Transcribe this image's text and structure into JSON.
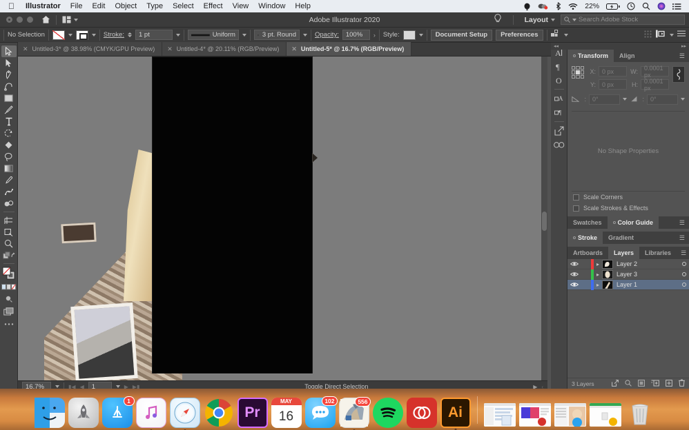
{
  "macbar": {
    "apple_icon": "apple-icon",
    "app_name": "Illustrator",
    "menus": [
      "File",
      "Edit",
      "Object",
      "Type",
      "Select",
      "Effect",
      "View",
      "Window",
      "Help"
    ],
    "status": {
      "battery_percent": "22%",
      "icons": [
        "dropbox-icon",
        "cloud-sync-icon",
        "bluetooth-icon",
        "wifi-icon",
        "battery-icon",
        "timemachine-icon",
        "spotlight-search-icon",
        "siri-icon",
        "control-center-icon"
      ]
    }
  },
  "appbar": {
    "title": "Adobe Illustrator 2020",
    "home_icon": "home-icon",
    "arrange_icon": "arrange-documents-icon",
    "bulb_icon": "discover-bulb-icon",
    "layout_label": "Layout",
    "search_placeholder": "Search Adobe Stock",
    "search_icon": "search-icon"
  },
  "control_bar": {
    "selection_status": "No Selection",
    "fill_label": "fill-swatch",
    "stroke_swatch_label": "stroke-swatch",
    "stroke_label": "Stroke:",
    "stroke_weight": "1 pt",
    "stroke_profile": "Uniform",
    "brush_definition": "3 pt. Round",
    "opacity_label": "Opacity:",
    "opacity_value": "100%",
    "style_label": "Style:",
    "document_setup": "Document Setup",
    "preferences": "Preferences",
    "align_icon": "align-objects-icon",
    "more_options_icon": "more-options-icon"
  },
  "tabs": [
    {
      "title": "Untitled-3* @ 38.98% (CMYK/GPU Preview)",
      "active": false,
      "close_icon": "close-icon"
    },
    {
      "title": "Untitled-4* @ 20.11% (RGB/Preview)",
      "active": false,
      "close_icon": "close-icon"
    },
    {
      "title": "Untitled-5* @ 16.7% (RGB/Preview)",
      "active": true,
      "close_icon": "close-icon"
    }
  ],
  "tools": [
    {
      "name": "selection-tool",
      "selected": true
    },
    {
      "name": "direct-selection-tool",
      "selected": false
    },
    {
      "name": "pen-tool",
      "selected": false
    },
    {
      "name": "curvature-tool",
      "selected": false
    },
    {
      "name": "rectangle-tool",
      "selected": false
    },
    {
      "name": "paintbrush-tool",
      "selected": false
    },
    {
      "name": "type-tool",
      "selected": false
    },
    {
      "name": "rotate-tool",
      "selected": false
    },
    {
      "name": "shape-builder-tool",
      "selected": false
    },
    {
      "name": "lasso-tool",
      "selected": false
    },
    {
      "name": "gradient-tool",
      "selected": false
    },
    {
      "name": "eyedropper-tool",
      "selected": false
    },
    {
      "name": "puppet-warp-tool",
      "selected": false
    },
    {
      "name": "blend-tool",
      "selected": false
    },
    {
      "name": "artboard-tool",
      "selected": false
    },
    {
      "name": "slice-tool",
      "selected": false
    },
    {
      "name": "zoom-tool",
      "selected": false
    },
    {
      "name": "screen-mode-tool",
      "selected": false
    },
    {
      "name": "fill-stroke-swatch",
      "selected": false
    },
    {
      "name": "color-mode-row",
      "selected": false
    },
    {
      "name": "drawing-mode-tool",
      "selected": false
    },
    {
      "name": "change-screen-mode-tool",
      "selected": false
    },
    {
      "name": "edit-toolbar-icon",
      "selected": false
    }
  ],
  "canvas": {
    "artboard_label": "artboard-1",
    "black_rect_color": "#040404",
    "background_color": "#7c7c7c"
  },
  "statusbar": {
    "zoom_level": "16.7%",
    "page_number": "1",
    "tool_hint": "Toggle Direct Selection",
    "first_icon": "first-page-icon",
    "prev_icon": "previous-page-icon",
    "next_icon": "next-page-icon",
    "last_icon": "last-page-icon"
  },
  "right_rail": [
    {
      "name": "character-panel-icon",
      "glyph": "A"
    },
    {
      "name": "paragraph-panel-icon",
      "glyph": "¶"
    },
    {
      "name": "opentype-panel-icon",
      "glyph": "O"
    },
    {
      "name": "character-styles-icon",
      "glyph": "A"
    },
    {
      "name": "paragraph-styles-icon",
      "glyph": "¶"
    },
    {
      "name": "asset-export-icon",
      "glyph": "⬈"
    },
    {
      "name": "links-panel-icon",
      "glyph": "∞"
    }
  ],
  "panels": {
    "transform": {
      "tabs": [
        {
          "label": "Transform",
          "active": true
        },
        {
          "label": "Align",
          "active": false
        }
      ],
      "menu_icon": "panel-menu-icon",
      "reference_point_icon": "reference-point-selector",
      "x_label": "X:",
      "x_value": "0 px",
      "y_label": "Y:",
      "y_value": "0 px",
      "w_label": "W:",
      "w_value": "0.0001 px",
      "h_label": "H:",
      "h_value": "0.0001 px",
      "angle_label": "angle-icon",
      "angle_value": "0°",
      "shear_label": "shear-icon",
      "shear_value": "0°",
      "link_icon": "constrain-proportions-icon",
      "no_shape_properties": "No Shape Properties",
      "scale_corners": "Scale Corners",
      "scale_strokes": "Scale Strokes & Effects"
    },
    "swatches_group": {
      "tabs": [
        {
          "label": "Swatches",
          "active": false
        },
        {
          "label": "Color Guide",
          "active": true
        }
      ],
      "menu_icon": "panel-menu-icon"
    },
    "stroke_group": {
      "tabs": [
        {
          "label": "Stroke",
          "active": true
        },
        {
          "label": "Gradient",
          "active": false
        }
      ],
      "menu_icon": "panel-menu-icon"
    },
    "layers": {
      "tabs": [
        {
          "label": "Artboards",
          "active": false
        },
        {
          "label": "Layers",
          "active": true
        },
        {
          "label": "Libraries",
          "active": false
        }
      ],
      "menu_icon": "panel-menu-icon",
      "rows": [
        {
          "name": "Layer 2",
          "color": "#ef3a3a",
          "selected": false,
          "eye_icon": "eye-icon",
          "expand_icon": "chevron-right-icon",
          "target_icon": "target-circle-icon"
        },
        {
          "name": "Layer 3",
          "color": "#34c24a",
          "selected": false,
          "eye_icon": "eye-icon",
          "expand_icon": "chevron-right-icon",
          "target_icon": "target-circle-icon"
        },
        {
          "name": "Layer 1",
          "color": "#3e6df0",
          "selected": true,
          "eye_icon": "eye-icon",
          "expand_icon": "chevron-right-icon",
          "target_icon": "target-circle-icon"
        }
      ],
      "footer": {
        "count": "3 Layers",
        "icons": [
          "locate-object-icon",
          "search-icon",
          "make-mask-icon",
          "create-sublayer-icon",
          "new-layer-icon",
          "delete-layer-icon"
        ]
      }
    }
  },
  "dock": {
    "items": [
      {
        "name": "finder",
        "badge": ""
      },
      {
        "name": "launchpad",
        "badge": ""
      },
      {
        "name": "app-store",
        "badge": "1"
      },
      {
        "name": "itunes",
        "badge": ""
      },
      {
        "name": "safari",
        "badge": ""
      },
      {
        "name": "chrome",
        "badge": ""
      },
      {
        "name": "premiere-pro",
        "badge": ""
      },
      {
        "name": "calendar",
        "badge": "",
        "month": "MAY",
        "day": "16"
      },
      {
        "name": "messages",
        "badge": "102"
      },
      {
        "name": "mail",
        "badge": "556"
      },
      {
        "name": "spotify",
        "badge": ""
      },
      {
        "name": "creative-cloud",
        "badge": ""
      },
      {
        "name": "illustrator",
        "badge": ""
      }
    ],
    "minimized": [
      {
        "name": "minimized-mail-window"
      },
      {
        "name": "minimized-creative-cloud-window"
      },
      {
        "name": "minimized-messages-window"
      },
      {
        "name": "minimized-chrome-window"
      }
    ],
    "trash": {
      "name": "trash"
    }
  }
}
